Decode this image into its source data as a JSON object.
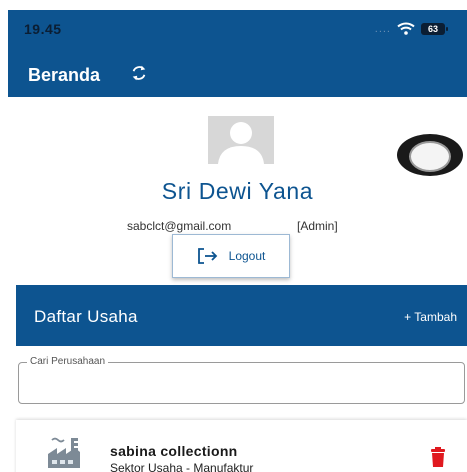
{
  "status_bar": {
    "time": "19.45",
    "signal_dots": "....",
    "battery_level": "63"
  },
  "header": {
    "title": "Beranda",
    "refresh_icon": "refresh-icon"
  },
  "profile": {
    "avatar_icon": "user-avatar-icon",
    "name": "Sri Dewi Yana",
    "email": "sabclct@gmail.com",
    "role": "[Admin]",
    "logout_label": "Logout"
  },
  "business_section": {
    "title": "Daftar Usaha",
    "add_label": "+ Tambah"
  },
  "search": {
    "label": "Cari Perusahaan",
    "value": ""
  },
  "businesses": [
    {
      "name": "sabina collectionn",
      "sector": "Sektor Usaha - Manufaktur",
      "icon": "factory-icon",
      "delete_icon": "trash-icon"
    }
  ],
  "colors": {
    "primary": "#0d5490",
    "delete": "#e0191f",
    "background": "#ffffff"
  }
}
